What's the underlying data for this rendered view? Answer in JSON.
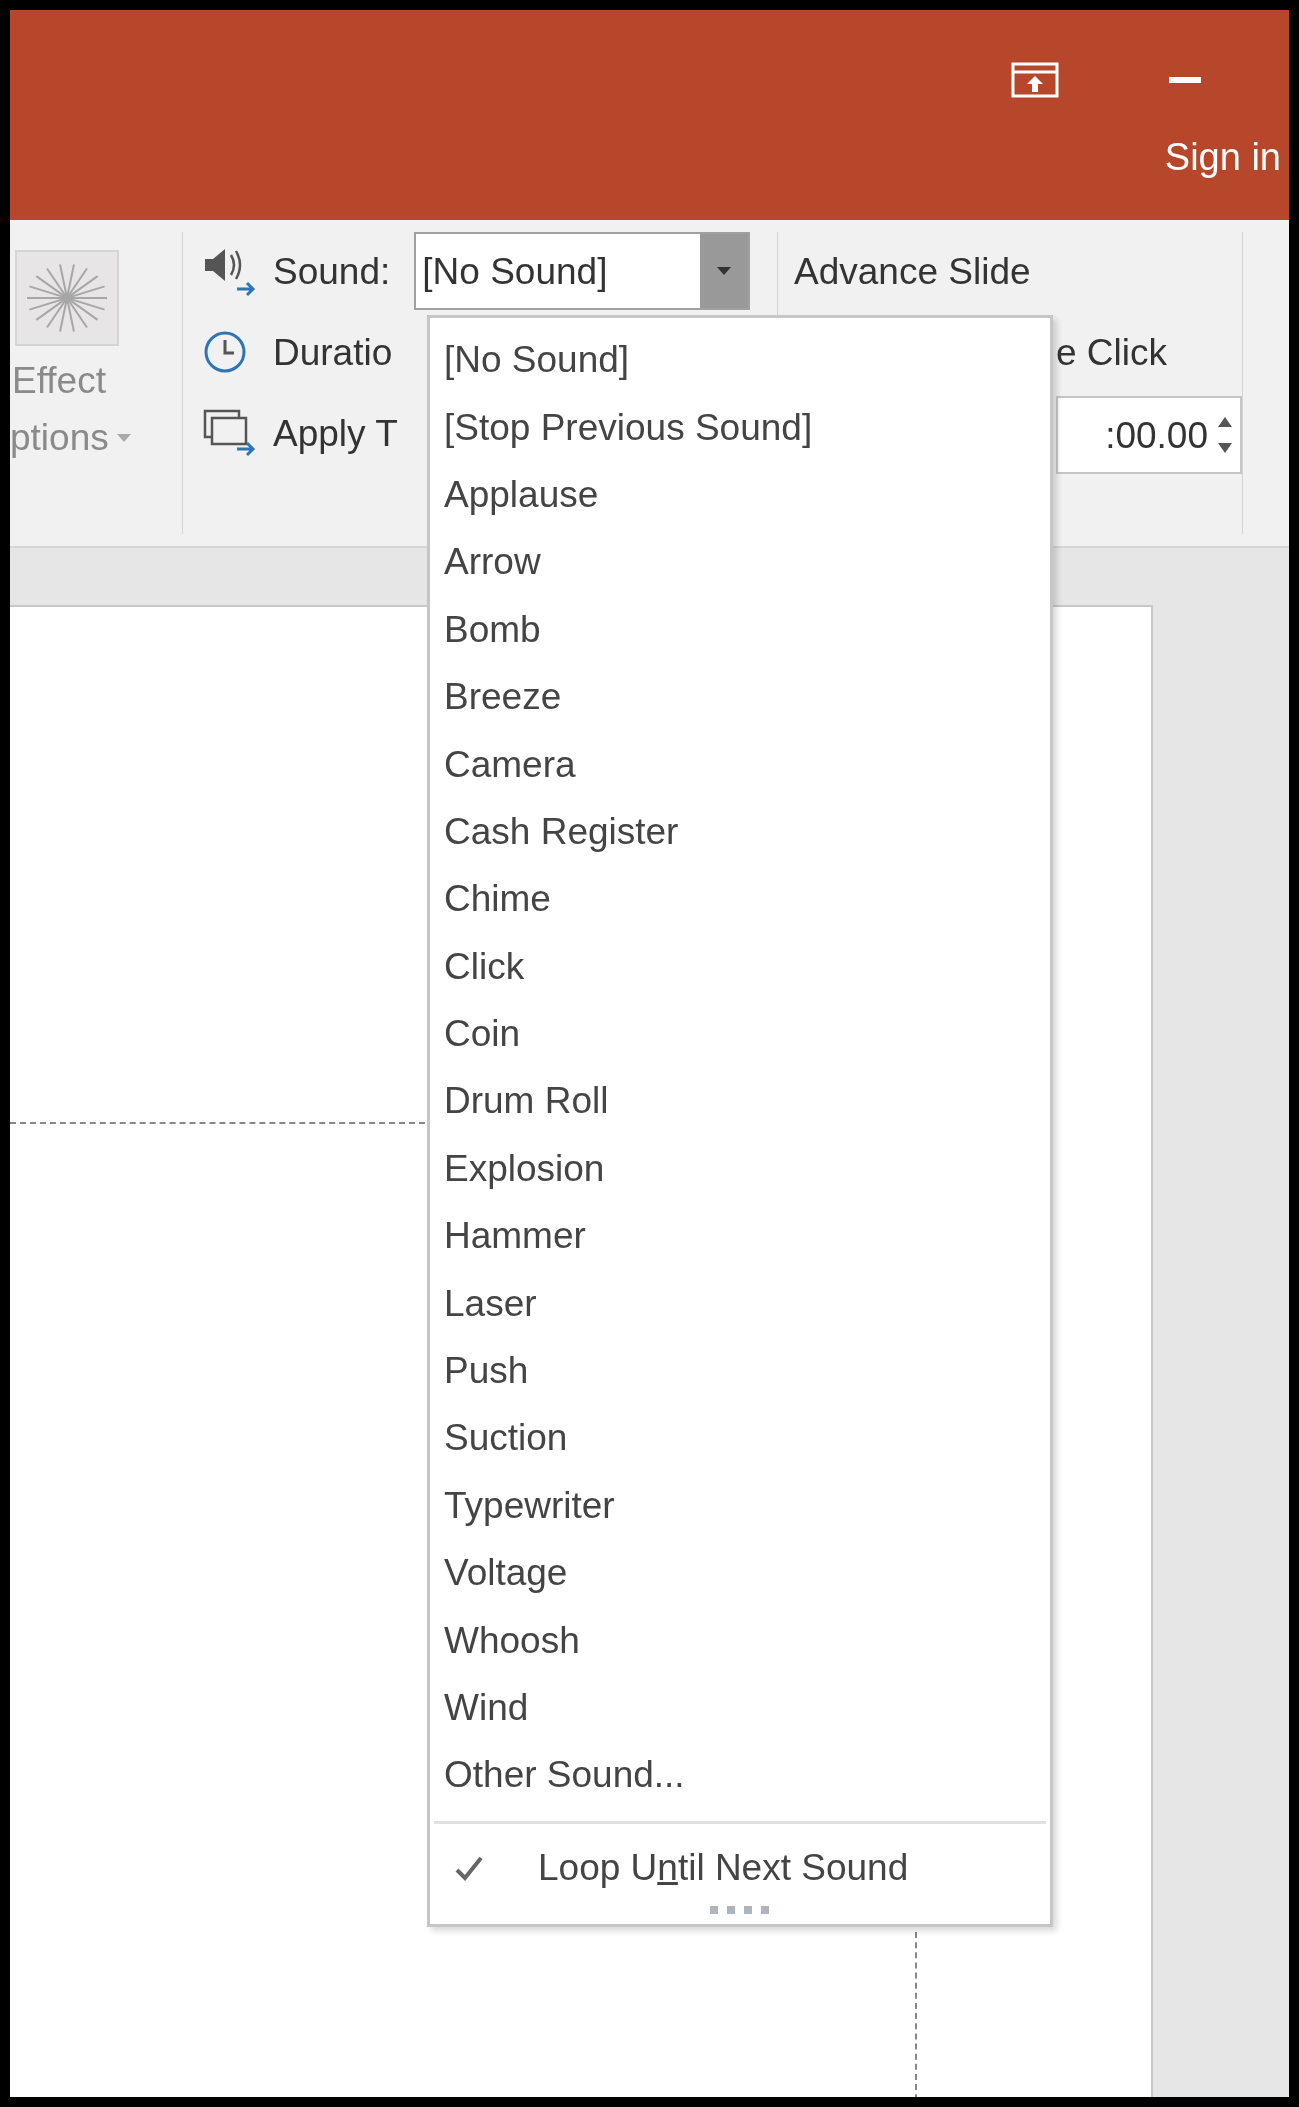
{
  "title_bar": {
    "sign_in": "Sign in"
  },
  "ribbon": {
    "effect_options": {
      "line_1": "Effect",
      "line_2": "ptions",
      "disabled": true
    },
    "sound": {
      "label": "Sound:",
      "value": "[No Sound]",
      "expanded": true
    },
    "duration": {
      "label": "Duratio"
    },
    "apply_to": {
      "label": "Apply T"
    },
    "advance_slide": {
      "title": "Advance Slide",
      "on_click": "e Click",
      "after_value": ":00.00"
    }
  },
  "sound_menu": {
    "items": [
      {
        "label": "[No Sound]"
      },
      {
        "label": "[Stop Previous Sound]"
      },
      {
        "label": "Applause"
      },
      {
        "label": "Arrow"
      },
      {
        "label": "Bomb"
      },
      {
        "label": "Breeze"
      },
      {
        "label": "Camera"
      },
      {
        "label": "Cash Register"
      },
      {
        "label": "Chime"
      },
      {
        "label": "Click"
      },
      {
        "label": "Coin"
      },
      {
        "label": "Drum Roll"
      },
      {
        "label": "Explosion"
      },
      {
        "label": "Hammer"
      },
      {
        "label": "Laser"
      },
      {
        "label": "Push"
      },
      {
        "label": "Suction"
      },
      {
        "label": "Typewriter"
      },
      {
        "label": "Voltage"
      },
      {
        "label": "Whoosh"
      },
      {
        "label": "Wind"
      },
      {
        "label": "Other Sound..."
      }
    ],
    "loop": {
      "before": "Loop U",
      "accelerator": "n",
      "after": "til Next Sound",
      "checked": true
    }
  }
}
